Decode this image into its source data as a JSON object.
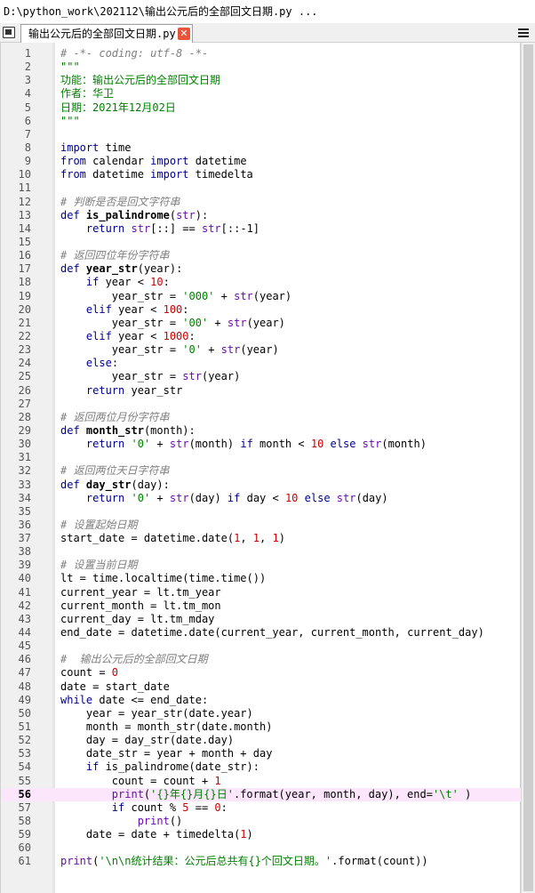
{
  "window": {
    "title": "D:\\python_work\\202112\\输出公元后的全部回文日期.py ..."
  },
  "tabbar": {
    "tab_label": "输出公元后的全部回文日期.py",
    "close_glyph": "✕"
  },
  "editor": {
    "current_line": 56,
    "lines": [
      {
        "n": "1",
        "tokens": [
          [
            "# -*- coding: utf-8 -*-",
            "comment"
          ]
        ]
      },
      {
        "n": "2",
        "tokens": [
          [
            "\"\"\"",
            "string"
          ]
        ]
      },
      {
        "n": "3",
        "tokens": [
          [
            "功能：输出公元后的全部回文日期",
            "string"
          ]
        ]
      },
      {
        "n": "4",
        "tokens": [
          [
            "作者：华卫",
            "string"
          ]
        ]
      },
      {
        "n": "5",
        "tokens": [
          [
            "日期：2021年12月02日",
            "string"
          ]
        ]
      },
      {
        "n": "6",
        "tokens": [
          [
            "\"\"\"",
            "string"
          ]
        ]
      },
      {
        "n": "7",
        "tokens": []
      },
      {
        "n": "8",
        "tokens": [
          [
            "import",
            "keyword"
          ],
          [
            " time",
            "plain"
          ]
        ]
      },
      {
        "n": "9",
        "tokens": [
          [
            "from",
            "keyword"
          ],
          [
            " calendar ",
            "plain"
          ],
          [
            "import",
            "keyword"
          ],
          [
            " datetime",
            "plain"
          ]
        ]
      },
      {
        "n": "10",
        "tokens": [
          [
            "from",
            "keyword"
          ],
          [
            " datetime ",
            "plain"
          ],
          [
            "import",
            "keyword"
          ],
          [
            " timedelta",
            "plain"
          ]
        ]
      },
      {
        "n": "11",
        "tokens": []
      },
      {
        "n": "12",
        "tokens": [
          [
            "# 判断是否是回文字符串",
            "comment"
          ]
        ]
      },
      {
        "n": "13",
        "tokens": [
          [
            "def",
            "keyword"
          ],
          [
            " ",
            "plain"
          ],
          [
            "is_palindrome",
            "def"
          ],
          [
            "(",
            "plain"
          ],
          [
            "str",
            "builtin"
          ],
          [
            "):",
            "plain"
          ]
        ]
      },
      {
        "n": "14",
        "tokens": [
          [
            "    ",
            "plain"
          ],
          [
            "return",
            "keyword"
          ],
          [
            " ",
            "plain"
          ],
          [
            "str",
            "builtin"
          ],
          [
            "[::] == ",
            "plain"
          ],
          [
            "str",
            "builtin"
          ],
          [
            "[::-1]",
            "plain"
          ]
        ]
      },
      {
        "n": "15",
        "tokens": []
      },
      {
        "n": "16",
        "tokens": [
          [
            "# 返回四位年份字符串",
            "comment"
          ]
        ]
      },
      {
        "n": "17",
        "tokens": [
          [
            "def",
            "keyword"
          ],
          [
            " ",
            "plain"
          ],
          [
            "year_str",
            "def"
          ],
          [
            "(year):",
            "plain"
          ]
        ]
      },
      {
        "n": "18",
        "tokens": [
          [
            "    ",
            "plain"
          ],
          [
            "if",
            "keyword"
          ],
          [
            " year < ",
            "plain"
          ],
          [
            "10",
            "number"
          ],
          [
            ":",
            "plain"
          ]
        ]
      },
      {
        "n": "19",
        "tokens": [
          [
            "        year_str = ",
            "plain"
          ],
          [
            "'000'",
            "string"
          ],
          [
            " + ",
            "plain"
          ],
          [
            "str",
            "builtin"
          ],
          [
            "(year)",
            "plain"
          ]
        ]
      },
      {
        "n": "20",
        "tokens": [
          [
            "    ",
            "plain"
          ],
          [
            "elif",
            "keyword"
          ],
          [
            " year < ",
            "plain"
          ],
          [
            "100",
            "number"
          ],
          [
            ":",
            "plain"
          ]
        ]
      },
      {
        "n": "21",
        "tokens": [
          [
            "        year_str = ",
            "plain"
          ],
          [
            "'00'",
            "string"
          ],
          [
            " + ",
            "plain"
          ],
          [
            "str",
            "builtin"
          ],
          [
            "(year)",
            "plain"
          ]
        ]
      },
      {
        "n": "22",
        "tokens": [
          [
            "    ",
            "plain"
          ],
          [
            "elif",
            "keyword"
          ],
          [
            " year < ",
            "plain"
          ],
          [
            "1000",
            "number"
          ],
          [
            ":",
            "plain"
          ]
        ]
      },
      {
        "n": "23",
        "tokens": [
          [
            "        year_str = ",
            "plain"
          ],
          [
            "'0'",
            "string"
          ],
          [
            " + ",
            "plain"
          ],
          [
            "str",
            "builtin"
          ],
          [
            "(year)",
            "plain"
          ]
        ]
      },
      {
        "n": "24",
        "tokens": [
          [
            "    ",
            "plain"
          ],
          [
            "else",
            "keyword"
          ],
          [
            ":",
            "plain"
          ]
        ]
      },
      {
        "n": "25",
        "tokens": [
          [
            "        year_str = ",
            "plain"
          ],
          [
            "str",
            "builtin"
          ],
          [
            "(year)",
            "plain"
          ]
        ]
      },
      {
        "n": "26",
        "tokens": [
          [
            "    ",
            "plain"
          ],
          [
            "return",
            "keyword"
          ],
          [
            " year_str",
            "plain"
          ]
        ]
      },
      {
        "n": "27",
        "tokens": []
      },
      {
        "n": "28",
        "tokens": [
          [
            "# 返回两位月份字符串",
            "comment"
          ]
        ]
      },
      {
        "n": "29",
        "tokens": [
          [
            "def",
            "keyword"
          ],
          [
            " ",
            "plain"
          ],
          [
            "month_str",
            "def"
          ],
          [
            "(month):",
            "plain"
          ]
        ]
      },
      {
        "n": "30",
        "tokens": [
          [
            "    ",
            "plain"
          ],
          [
            "return",
            "keyword"
          ],
          [
            " ",
            "plain"
          ],
          [
            "'0'",
            "string"
          ],
          [
            " + ",
            "plain"
          ],
          [
            "str",
            "builtin"
          ],
          [
            "(month) ",
            "plain"
          ],
          [
            "if",
            "keyword"
          ],
          [
            " month < ",
            "plain"
          ],
          [
            "10",
            "number"
          ],
          [
            " ",
            "plain"
          ],
          [
            "else",
            "keyword"
          ],
          [
            " ",
            "plain"
          ],
          [
            "str",
            "builtin"
          ],
          [
            "(month)",
            "plain"
          ]
        ]
      },
      {
        "n": "31",
        "tokens": []
      },
      {
        "n": "32",
        "tokens": [
          [
            "# 返回两位天日字符串",
            "comment"
          ]
        ]
      },
      {
        "n": "33",
        "tokens": [
          [
            "def",
            "keyword"
          ],
          [
            " ",
            "plain"
          ],
          [
            "day_str",
            "def"
          ],
          [
            "(day):",
            "plain"
          ]
        ]
      },
      {
        "n": "34",
        "tokens": [
          [
            "    ",
            "plain"
          ],
          [
            "return",
            "keyword"
          ],
          [
            " ",
            "plain"
          ],
          [
            "'0'",
            "string"
          ],
          [
            " + ",
            "plain"
          ],
          [
            "str",
            "builtin"
          ],
          [
            "(day) ",
            "plain"
          ],
          [
            "if",
            "keyword"
          ],
          [
            " day < ",
            "plain"
          ],
          [
            "10",
            "number"
          ],
          [
            " ",
            "plain"
          ],
          [
            "else",
            "keyword"
          ],
          [
            " ",
            "plain"
          ],
          [
            "str",
            "builtin"
          ],
          [
            "(day)",
            "plain"
          ]
        ]
      },
      {
        "n": "35",
        "tokens": []
      },
      {
        "n": "36",
        "tokens": [
          [
            "# 设置起始日期",
            "comment"
          ]
        ]
      },
      {
        "n": "37",
        "tokens": [
          [
            "start_date = datetime.date(",
            "plain"
          ],
          [
            "1",
            "number"
          ],
          [
            ", ",
            "plain"
          ],
          [
            "1",
            "number"
          ],
          [
            ", ",
            "plain"
          ],
          [
            "1",
            "number"
          ],
          [
            ")",
            "plain"
          ]
        ]
      },
      {
        "n": "38",
        "tokens": []
      },
      {
        "n": "39",
        "tokens": [
          [
            "# 设置当前日期",
            "comment"
          ]
        ]
      },
      {
        "n": "40",
        "tokens": [
          [
            "lt = time.localtime(time.time())",
            "plain"
          ]
        ]
      },
      {
        "n": "41",
        "tokens": [
          [
            "current_year = lt.tm_year",
            "plain"
          ]
        ]
      },
      {
        "n": "42",
        "tokens": [
          [
            "current_month = lt.tm_mon",
            "plain"
          ]
        ]
      },
      {
        "n": "43",
        "tokens": [
          [
            "current_day = lt.tm_mday",
            "plain"
          ]
        ]
      },
      {
        "n": "44",
        "tokens": [
          [
            "end_date = datetime.date(current_year, current_month, current_day)",
            "plain"
          ]
        ]
      },
      {
        "n": "45",
        "tokens": []
      },
      {
        "n": "46",
        "tokens": [
          [
            "#  输出公元后的全部回文日期",
            "comment"
          ]
        ]
      },
      {
        "n": "47",
        "tokens": [
          [
            "count = ",
            "plain"
          ],
          [
            "0",
            "number"
          ]
        ]
      },
      {
        "n": "48",
        "tokens": [
          [
            "date = start_date",
            "plain"
          ]
        ]
      },
      {
        "n": "49",
        "tokens": [
          [
            "while",
            "keyword"
          ],
          [
            " date <= end_date:",
            "plain"
          ]
        ]
      },
      {
        "n": "50",
        "tokens": [
          [
            "    year = year_str(date.year)",
            "plain"
          ]
        ]
      },
      {
        "n": "51",
        "tokens": [
          [
            "    month = month_str(date.month)",
            "plain"
          ]
        ]
      },
      {
        "n": "52",
        "tokens": [
          [
            "    day = day_str(date.day)",
            "plain"
          ]
        ]
      },
      {
        "n": "53",
        "tokens": [
          [
            "    date_str = year + month + day",
            "plain"
          ]
        ]
      },
      {
        "n": "54",
        "tokens": [
          [
            "    ",
            "plain"
          ],
          [
            "if",
            "keyword"
          ],
          [
            " is_palindrome(date_str):",
            "plain"
          ]
        ]
      },
      {
        "n": "55",
        "tokens": [
          [
            "        count = count + ",
            "plain"
          ],
          [
            "1",
            "number"
          ]
        ]
      },
      {
        "n": "56",
        "tokens": [
          [
            "        ",
            "plain"
          ],
          [
            "print",
            "builtin"
          ],
          [
            "(",
            "plain"
          ],
          [
            "'{}年{}月{}日'",
            "string"
          ],
          [
            ".format(year, month, day), end=",
            "plain"
          ],
          [
            "'\\t'",
            "string"
          ],
          [
            " )",
            "plain"
          ]
        ]
      },
      {
        "n": "57",
        "tokens": [
          [
            "        ",
            "plain"
          ],
          [
            "if",
            "keyword"
          ],
          [
            " count % ",
            "plain"
          ],
          [
            "5",
            "number"
          ],
          [
            " == ",
            "plain"
          ],
          [
            "0",
            "number"
          ],
          [
            ":",
            "plain"
          ]
        ]
      },
      {
        "n": "58",
        "tokens": [
          [
            "            ",
            "plain"
          ],
          [
            "print",
            "builtin"
          ],
          [
            "()",
            "plain"
          ]
        ]
      },
      {
        "n": "59",
        "tokens": [
          [
            "    date = date + timedelta(",
            "plain"
          ],
          [
            "1",
            "number"
          ],
          [
            ")",
            "plain"
          ]
        ]
      },
      {
        "n": "60",
        "tokens": []
      },
      {
        "n": "61",
        "tokens": [
          [
            "print",
            "builtin"
          ],
          [
            "(",
            "plain"
          ],
          [
            "'\\n\\n统计结果：公元后总共有{}个回文日期。'",
            "string"
          ],
          [
            ".format(count))",
            "plain"
          ]
        ]
      }
    ]
  }
}
